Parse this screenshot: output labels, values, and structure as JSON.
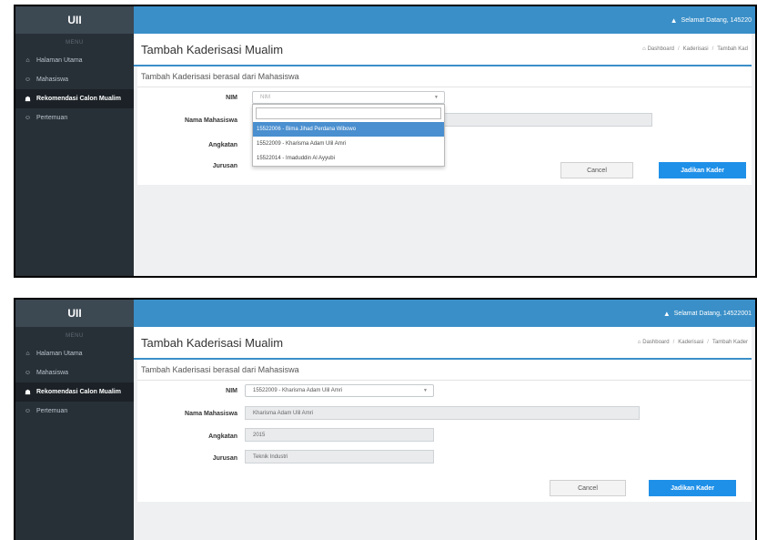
{
  "frames": [
    {
      "brand": "UII",
      "menu_head": "MENU",
      "sidebar": [
        {
          "label": "Halaman Utama",
          "icon": "home-icon",
          "glyph": "⌂"
        },
        {
          "label": "Mahasiswa",
          "icon": "users-icon",
          "glyph": "☺"
        },
        {
          "label": "Rekomendasi Calon Mualim",
          "icon": "group-icon",
          "glyph": "☗"
        },
        {
          "label": "Pertemuan",
          "icon": "users-icon",
          "glyph": "☺"
        }
      ],
      "greeting": "Selamat Datang, 145220",
      "page_title": "Tambah Kaderisasi Mualim",
      "breadcrumb": [
        "Dashboard",
        "Kaderisasi",
        "Tambah Kad"
      ],
      "panel_title": "Tambah Kaderisasi berasal dari Mahasiswa",
      "labels": {
        "nim": "NIM",
        "nama": "Nama Mahasiswa",
        "angkatan": "Angkatan",
        "jurusan": "Jurusan"
      },
      "nim_value": "NIM",
      "nama_value": "",
      "angkatan_value": "",
      "jurusan_value": "",
      "dropdown_options": [
        "15522006 - Bima Jihad Perdana Wibowo",
        "15522009 - Kharisma Adam Ulil Amri",
        "15522014 - Imaduddin Al Ayyubi"
      ],
      "cancel_label": "Cancel",
      "submit_label": "Jadikan Kader"
    },
    {
      "brand": "UII",
      "menu_head": "MENU",
      "sidebar": [
        {
          "label": "Halaman Utama",
          "icon": "home-icon",
          "glyph": "⌂"
        },
        {
          "label": "Mahasiswa",
          "icon": "users-icon",
          "glyph": "☺"
        },
        {
          "label": "Rekomendasi Calon Mualim",
          "icon": "group-icon",
          "glyph": "☗"
        },
        {
          "label": "Pertemuan",
          "icon": "users-icon",
          "glyph": "☺"
        }
      ],
      "greeting": "Selamat Datang, 14522001",
      "page_title": "Tambah Kaderisasi Mualim",
      "breadcrumb": [
        "Dashboard",
        "Kaderisasi",
        "Tambah Kader"
      ],
      "panel_title": "Tambah Kaderisasi berasal dari Mahasiswa",
      "labels": {
        "nim": "NIM",
        "nama": "Nama Mahasiswa",
        "angkatan": "Angkatan",
        "jurusan": "Jurusan"
      },
      "nim_value": "15522009 - Kharisma Adam Ulil Amri",
      "nama_value": "Kharisma Adam Ulil Amri",
      "angkatan_value": "2015",
      "jurusan_value": "Teknik Industri",
      "cancel_label": "Cancel",
      "submit_label": "Jadikan Kader"
    }
  ],
  "colors": {
    "sidebar": "#283037",
    "topbar": "#3a8fc8",
    "primary_button": "#1f90e8",
    "dropdown_highlight": "#4a8fcf"
  }
}
